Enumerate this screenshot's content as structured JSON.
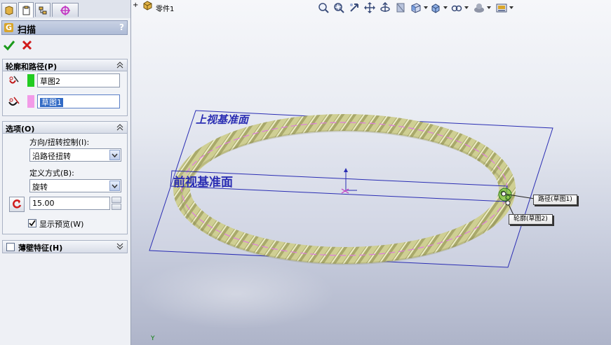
{
  "property_manager": {
    "tabs": [
      {
        "icon": "feature-tree-icon"
      },
      {
        "icon": "property-manager-icon"
      },
      {
        "icon": "configuration-icon"
      },
      {
        "icon": "dimxpert-icon"
      }
    ],
    "title": "扫描",
    "help_label": "?",
    "ok_icon": "check-icon",
    "cancel_icon": "x-icon",
    "profile_path_group": {
      "header": "轮廓和路径(P)",
      "profile_value": "草图2",
      "profile_color": "#22cc22",
      "path_value": "草图1",
      "path_color": "#f29be8"
    },
    "options_group": {
      "header": "选项(O)",
      "orientation_label": "方向/扭转控制(I):",
      "orientation_value": "沿路径扭转",
      "define_label": "定义方式(B):",
      "define_value": "旋转",
      "twist_value": "15.00",
      "preview_label": "显示预览(W)",
      "preview_checked": true
    },
    "thin_feature_group": {
      "header": "薄壁特征(H)",
      "checked": false
    }
  },
  "viewport": {
    "tree_expander": "+",
    "part_name": "零件1",
    "hud_icons": [
      "zoom-to-fit-icon",
      "zoom-area-icon",
      "previous-view-icon",
      "pan-icon",
      "rotate-icon",
      "section-view-icon",
      "view-orientation-icon",
      "display-style-icon",
      "hide-show-icon",
      "edit-appearance-icon",
      "apply-scene-icon"
    ],
    "plane_top_label": "上视基准面",
    "plane_front_label": "前视基准面",
    "callout_path": "路径(草图1)",
    "callout_profile": "轮廓(草图2)",
    "axis_y_label": "Y",
    "colors": {
      "plane_border": "#2a2db3",
      "rope_fill": "#c9c98a",
      "rope_dark": "#8d8d55",
      "path_line": "#e07be0"
    }
  }
}
